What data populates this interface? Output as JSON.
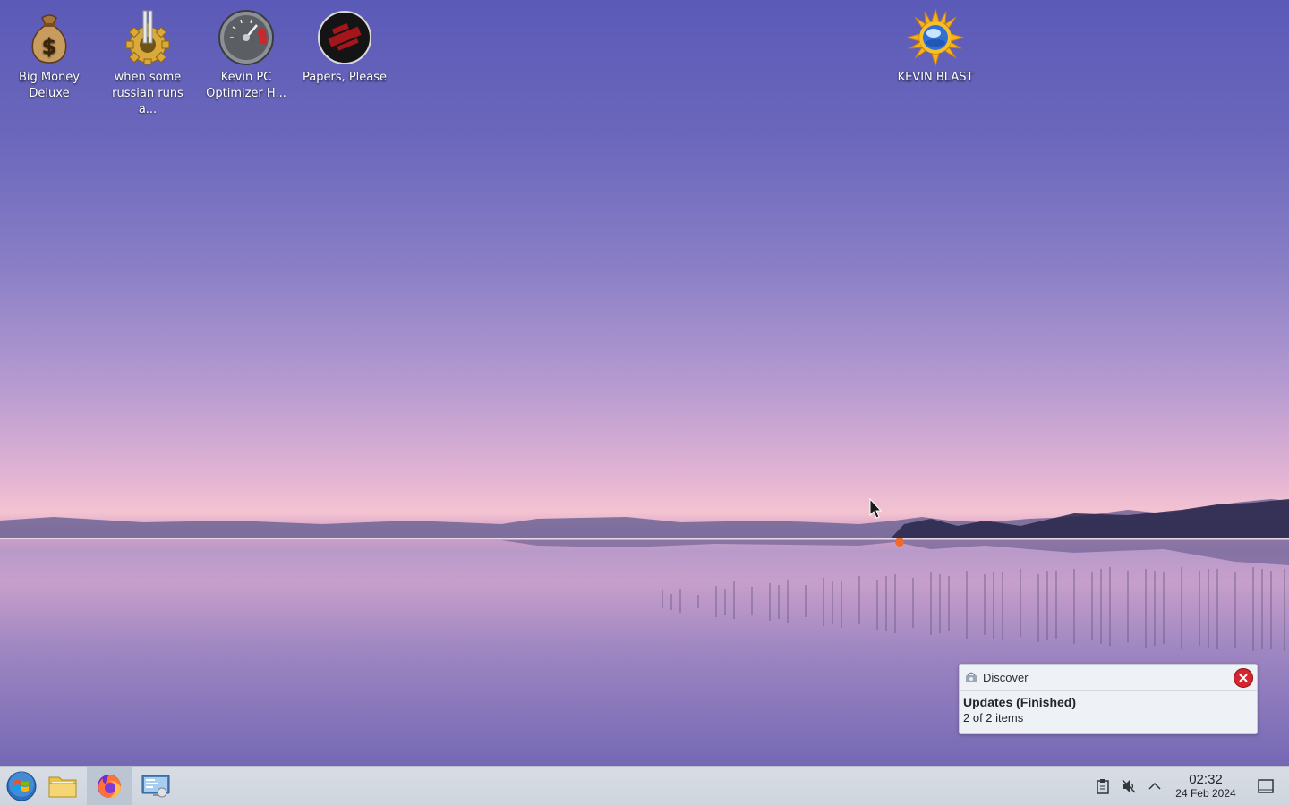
{
  "desktop": {
    "icons": [
      {
        "label": "Big Money\nDeluxe",
        "icon": "money-bag-icon"
      },
      {
        "label": "when some\nrussian runs a...",
        "icon": "gear-icon"
      },
      {
        "label": "Kevin PC\nOptimizer H...",
        "icon": "speedometer-icon"
      },
      {
        "label": "Papers, Please",
        "icon": "papers-please-icon"
      },
      {
        "label": "KEVIN BLAST",
        "icon": "sun-globe-icon"
      }
    ]
  },
  "notification": {
    "app_name": "Discover",
    "title": "Updates (Finished)",
    "body": "2 of 2 items",
    "app_icon": "discover-icon",
    "close_icon": "close-icon"
  },
  "taskbar": {
    "launchers": [
      {
        "name": "start-menu",
        "icon": "windows-start-icon"
      },
      {
        "name": "file-manager",
        "icon": "folder-icon"
      },
      {
        "name": "firefox",
        "icon": "firefox-icon",
        "active": true
      },
      {
        "name": "system-settings",
        "icon": "monitor-settings-icon"
      }
    ],
    "tray": {
      "icons": [
        "clipboard-icon",
        "speaker-muted-icon",
        "chevron-up-icon"
      ]
    },
    "clock": {
      "time": "02:32",
      "date": "24 Feb 2024"
    },
    "show_desktop_icon": "show-desktop-icon"
  }
}
